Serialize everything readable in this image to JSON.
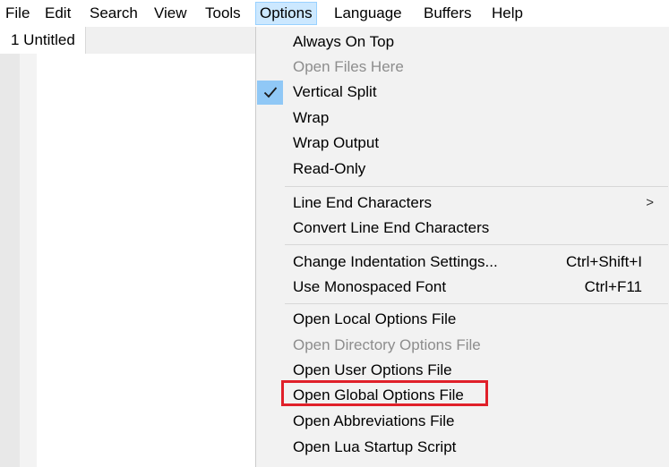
{
  "menubar": {
    "items": [
      "File",
      "Edit",
      "Search",
      "View",
      "Tools",
      "Options",
      "Language",
      "Buffers",
      "Help"
    ],
    "active": "Options"
  },
  "tabs": [
    {
      "label": "1 Untitled"
    }
  ],
  "options_menu": {
    "items": [
      {
        "label": "Always On Top",
        "enabled": true,
        "checked": false
      },
      {
        "label": "Open Files Here",
        "enabled": false,
        "checked": false
      },
      {
        "label": "Vertical Split",
        "enabled": true,
        "checked": true
      },
      {
        "label": "Wrap",
        "enabled": true,
        "checked": false
      },
      {
        "label": "Wrap Output",
        "enabled": true,
        "checked": false
      },
      {
        "label": "Read-Only",
        "enabled": true,
        "checked": false
      },
      {
        "label": "Line End Characters",
        "enabled": true,
        "submenu": true,
        "submenu_glyph": ">"
      },
      {
        "label": "Convert Line End Characters",
        "enabled": true
      },
      {
        "label": "Change Indentation Settings...",
        "enabled": true,
        "shortcut": "Ctrl+Shift+I"
      },
      {
        "label": "Use Monospaced Font",
        "enabled": true,
        "shortcut": "Ctrl+F11"
      },
      {
        "label": "Open Local Options File",
        "enabled": true
      },
      {
        "label": "Open Directory Options File",
        "enabled": false
      },
      {
        "label": "Open User Options File",
        "enabled": true
      },
      {
        "label": "Open Global Options File",
        "enabled": true,
        "highlighted": true
      },
      {
        "label": "Open Abbreviations File",
        "enabled": true
      },
      {
        "label": "Open Lua Startup Script",
        "enabled": true
      }
    ],
    "highlight_color": "#e0202a",
    "check_bg_color": "#90c8f6"
  }
}
